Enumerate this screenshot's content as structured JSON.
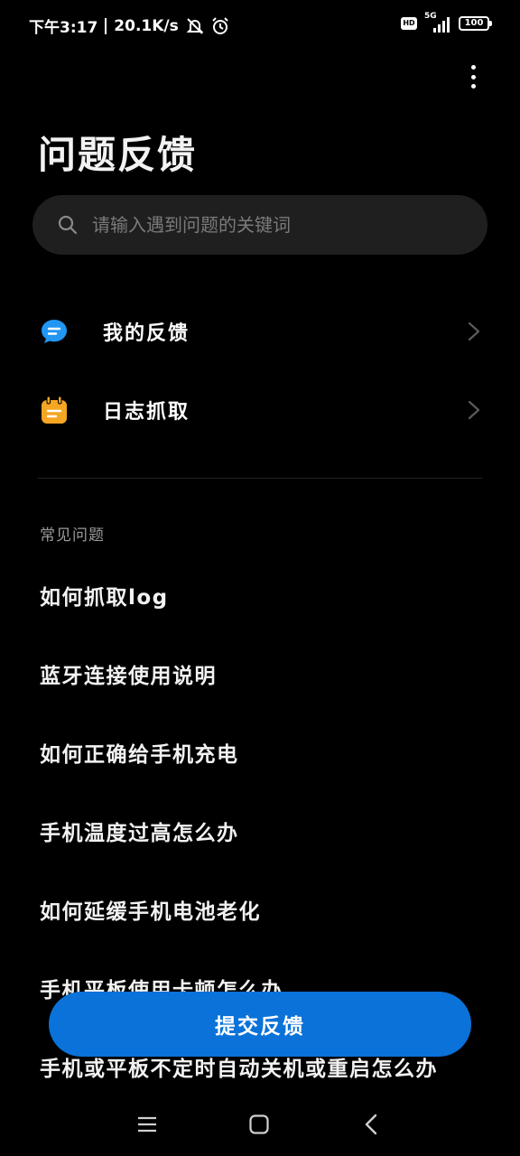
{
  "status_bar": {
    "time": "下午3:17",
    "net_speed": "20.1K/s",
    "hd_label": "HD",
    "network_type": "5G",
    "battery": "100"
  },
  "header": {
    "title": "问题反馈"
  },
  "search": {
    "placeholder": "请输入遇到问题的关键词"
  },
  "menu": [
    {
      "label": "我的反馈",
      "icon": "chat-bubble-icon",
      "color": "#2196f3"
    },
    {
      "label": "日志抓取",
      "icon": "calendar-log-icon",
      "color": "#f5a623"
    }
  ],
  "faq": {
    "section_title": "常见问题",
    "items": [
      "如何抓取log",
      "蓝牙连接使用说明",
      "如何正确给手机充电",
      "手机温度过高怎么办",
      "如何延缓手机电池老化",
      "手机平板使用卡顿怎么办",
      "手机或平板不定时自动关机或重启怎么办"
    ]
  },
  "submit": {
    "label": "提交反馈",
    "color": "#0a72d8"
  }
}
